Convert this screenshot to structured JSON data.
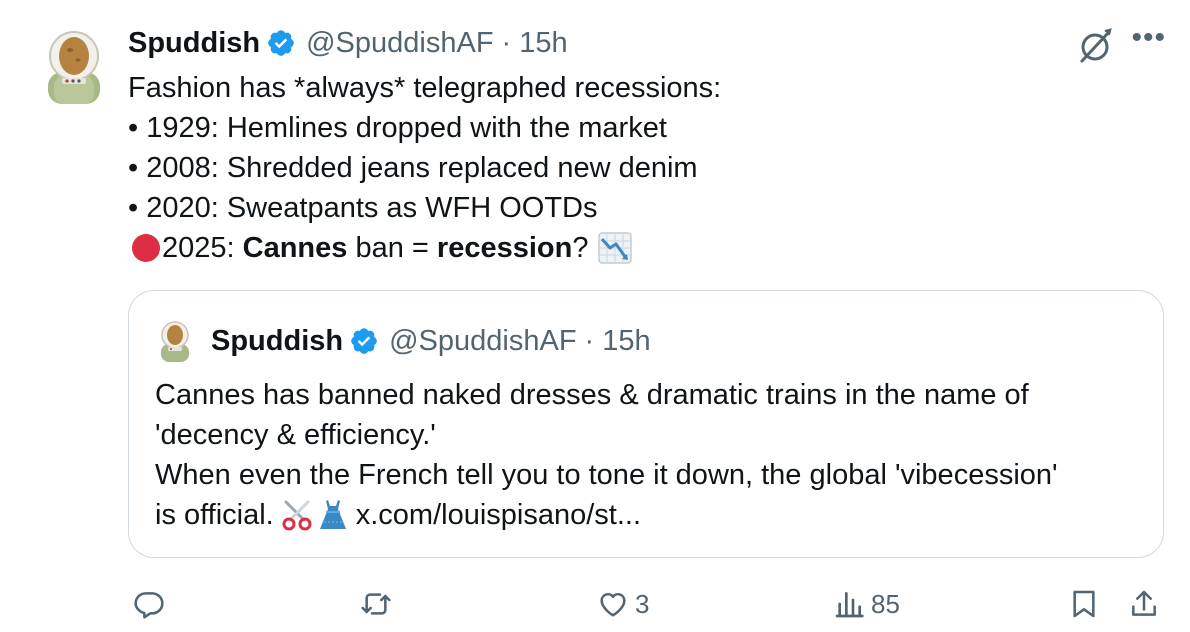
{
  "tweet": {
    "author_name": "Spuddish",
    "author_handle": "@SpuddishAF",
    "separator": "·",
    "time": "15h",
    "lines": {
      "l1": "Fashion has *always* telegraphed recessions:",
      "l2": "• 1929: Hemlines dropped with the market",
      "l3": "• 2008: Shredded jeans replaced new denim",
      "l4": "• 2020: Sweatpants as WFH OOTDs",
      "l5_prefix": "2025: ",
      "l5_bold1": "Cannes",
      "l5_mid": " ban = ",
      "l5_bold2": "recession",
      "l5_suffix": "?"
    }
  },
  "quote": {
    "author_name": "Spuddish",
    "author_handle": "@SpuddishAF",
    "separator": "·",
    "time": "15h",
    "lines": {
      "l1": "Cannes has banned naked dresses & dramatic trains in the name of",
      "l2": "'decency & efficiency.'",
      "l3": "When even the French tell you to tone it down, the global 'vibecession'",
      "l4_prefix": "is official.",
      "l4_link": "x.com/louispisano/st..."
    }
  },
  "actions": {
    "reply_count": "",
    "retweet_count": "",
    "like_count": "3",
    "views_count": "85"
  },
  "icons": [
    "avatar",
    "verified-badge-icon",
    "grok-icon",
    "more-icon",
    "red-circle-emoji",
    "chart-decreasing-emoji",
    "scissors-emoji",
    "dress-emoji",
    "reply-icon",
    "retweet-icon",
    "like-icon",
    "views-icon",
    "bookmark-icon",
    "share-icon"
  ],
  "colors": {
    "verified": "#1d9bf0",
    "text": "#0f1419",
    "muted": "#536471",
    "border": "#cfd9de",
    "red_circle": "#dd2e44"
  }
}
